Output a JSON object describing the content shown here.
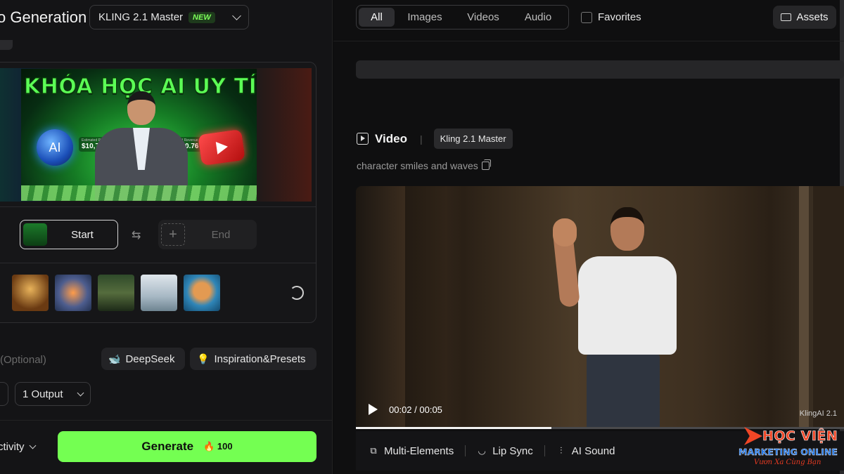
{
  "left_panel": {
    "title": "o Generation",
    "model_select": {
      "value": "KLING 2.1 Master",
      "badge": "NEW"
    },
    "hero_image": {
      "headline": "KHÓA HỌC AI UY TÍN",
      "orb_label": "AI",
      "revenue_1_label": "Estimated Revenue",
      "revenue_1": "$10,752.56",
      "revenue_2_label": "Estimated Revenue",
      "revenue_2": "$7,660.76"
    },
    "frames": {
      "start_label": "Start",
      "end_label": "End"
    },
    "optional_hint": "(Optional)",
    "deepseek_label": "DeepSeek",
    "inspiration_label": "Inspiration&Presets",
    "output_select": "1 Output",
    "activity_label": "ctivity",
    "generate": {
      "label": "Generate",
      "cost": "100"
    }
  },
  "right_panel": {
    "filters": [
      "All",
      "Images",
      "Videos",
      "Audio"
    ],
    "active_filter": "All",
    "favorites_label": "Favorites",
    "assets_label": "Assets",
    "video_card": {
      "type_label": "Video",
      "model_tag": "Kling 2.1 Master",
      "prompt": "character smiles and waves",
      "time": "00:02 / 00:05",
      "progress": 0.4,
      "watermark": "KlingAI 2.1"
    },
    "actions": [
      "Multi-Elements",
      "Lip Sync",
      "AI Sound"
    ]
  },
  "overlay_logo": {
    "line1": "HỌC VIỆN",
    "line2": "MARKETING ONLINE",
    "line3": "Vươn Xa Cùng Bạn"
  },
  "colors": {
    "accent_green": "#74ff52",
    "new_badge": "#7dff5a",
    "logo_red": "#f04626",
    "logo_blue": "#1a73e8"
  }
}
